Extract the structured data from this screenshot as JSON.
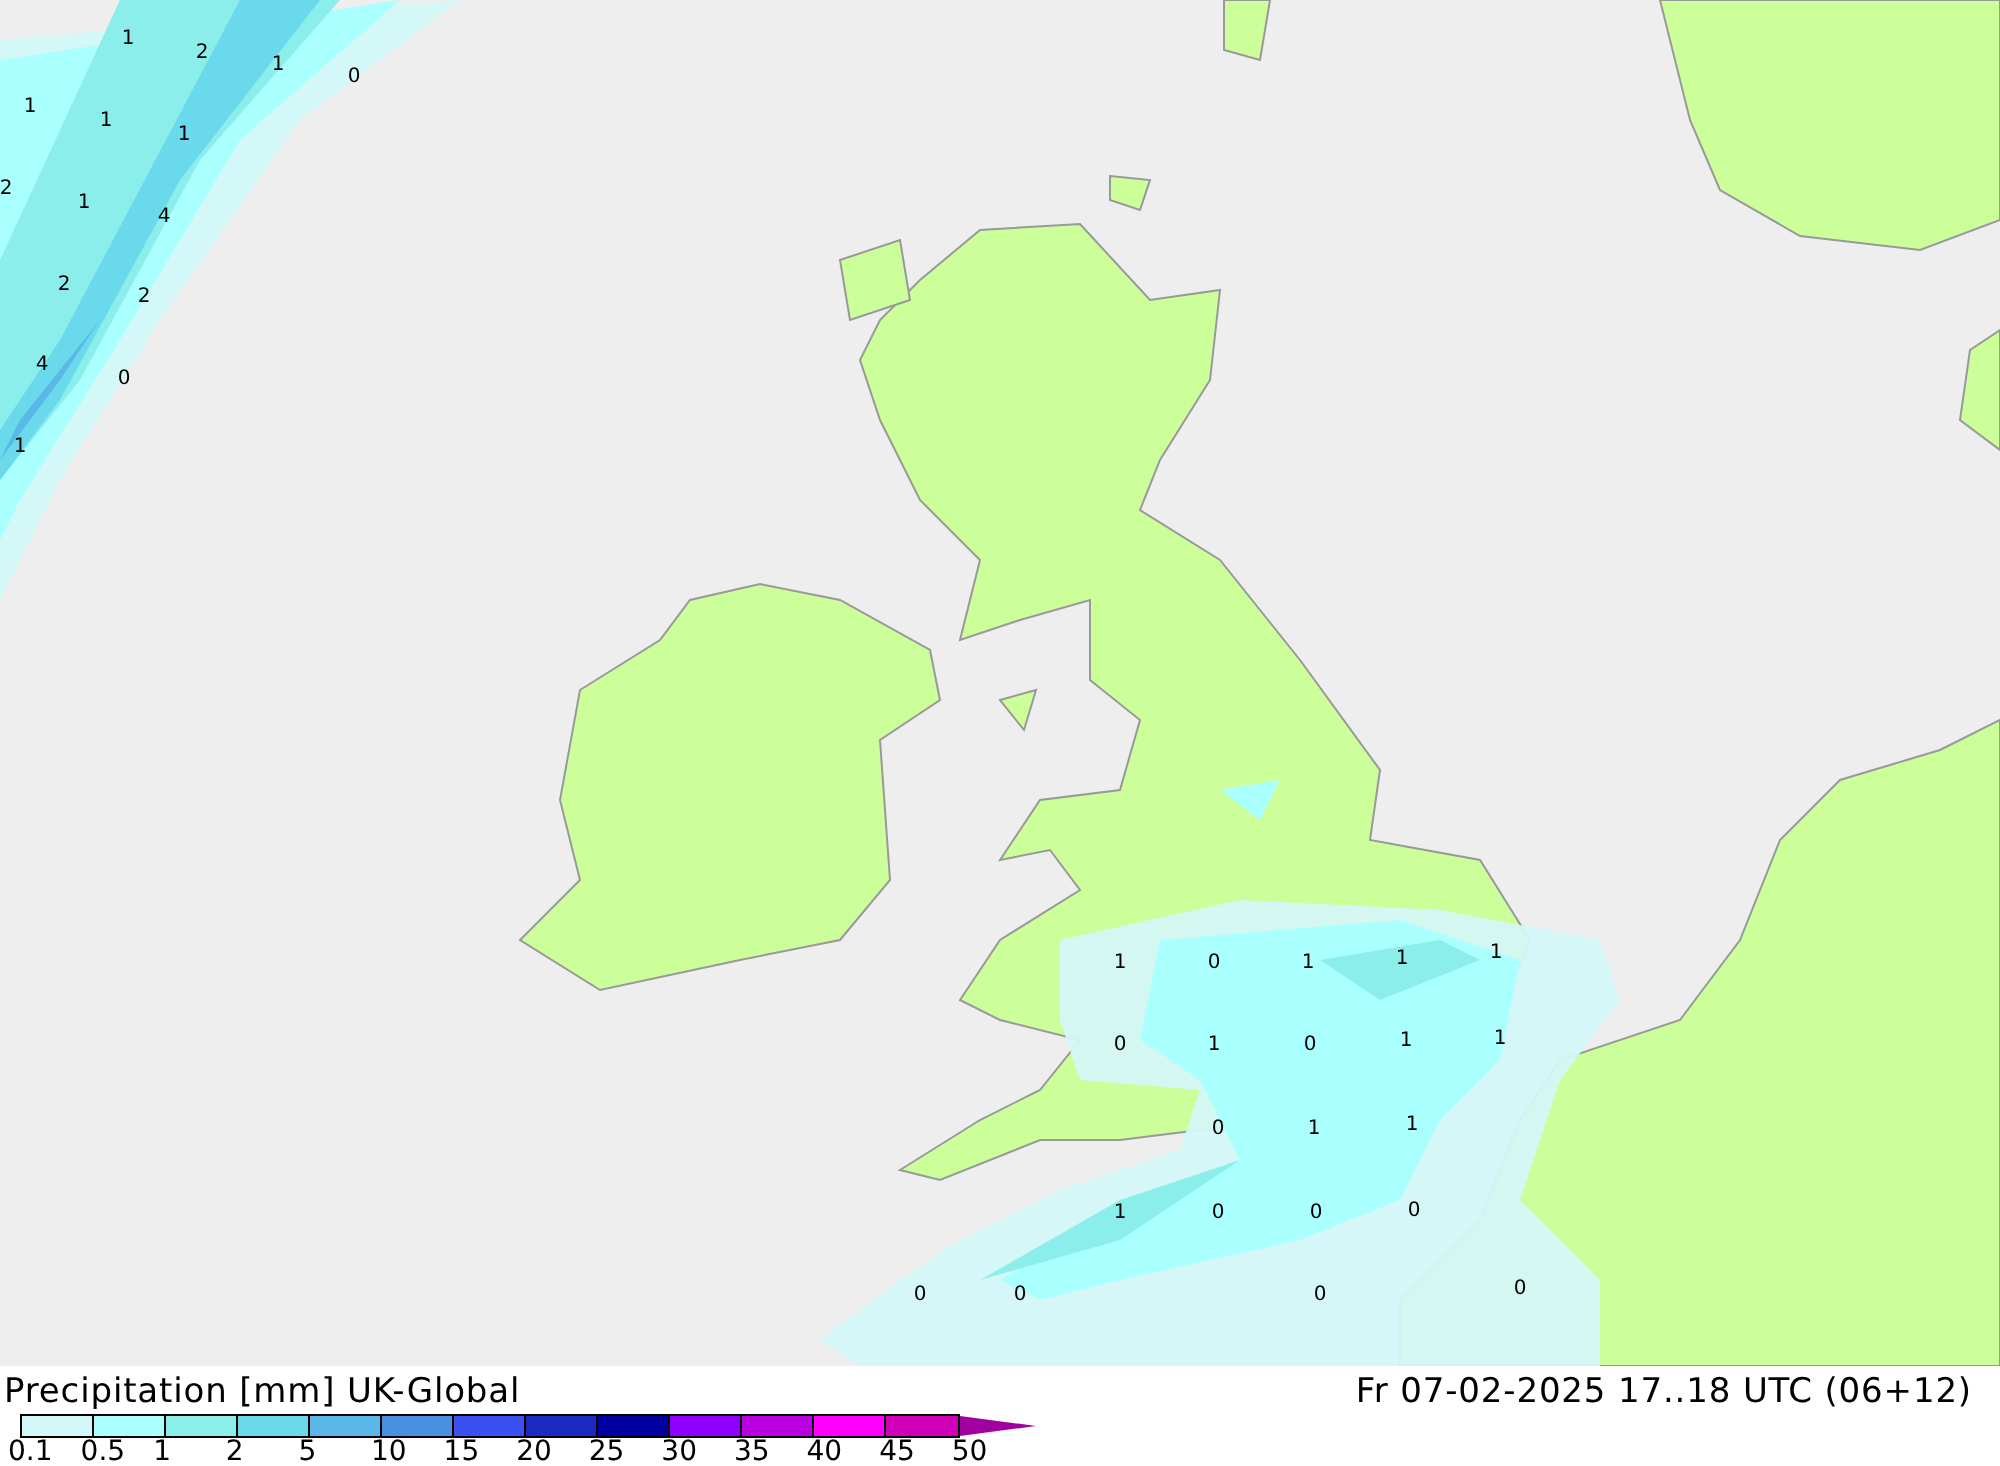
{
  "map": {
    "values": [
      "1",
      "2",
      "1",
      "0",
      "1",
      "1",
      "1",
      "2",
      "1",
      "4",
      "2",
      "2",
      "4",
      "0",
      "1",
      "1",
      "0",
      "1",
      "1",
      "1",
      "0",
      "1",
      "0",
      "1",
      "1",
      "0",
      "1",
      "1",
      "1",
      "0",
      "0",
      "0",
      "0",
      "0",
      "0",
      "0"
    ]
  },
  "footer": {
    "title": "Precipitation [mm] UK-Global",
    "run": "Fr 07-02-2025 17..18 UTC (06+12)"
  },
  "legend": {
    "swatches": [
      {
        "color": "#d4f7f7"
      },
      {
        "color": "#aaffff"
      },
      {
        "color": "#8ceeea"
      },
      {
        "color": "#6ad9ec"
      },
      {
        "color": "#5ab8e8"
      },
      {
        "color": "#4a90e0"
      },
      {
        "color": "#3a50f0"
      },
      {
        "color": "#1a2ac0"
      },
      {
        "color": "#0000a0"
      },
      {
        "color": "#9000ff"
      },
      {
        "color": "#b800e0"
      },
      {
        "color": "#ff00ff"
      },
      {
        "color": "#d000b8"
      }
    ],
    "labels": [
      "0.1",
      "0.5",
      "1",
      "2",
      "5",
      "10",
      "15",
      "20",
      "25",
      "30",
      "35",
      "40",
      "45",
      "50"
    ]
  }
}
